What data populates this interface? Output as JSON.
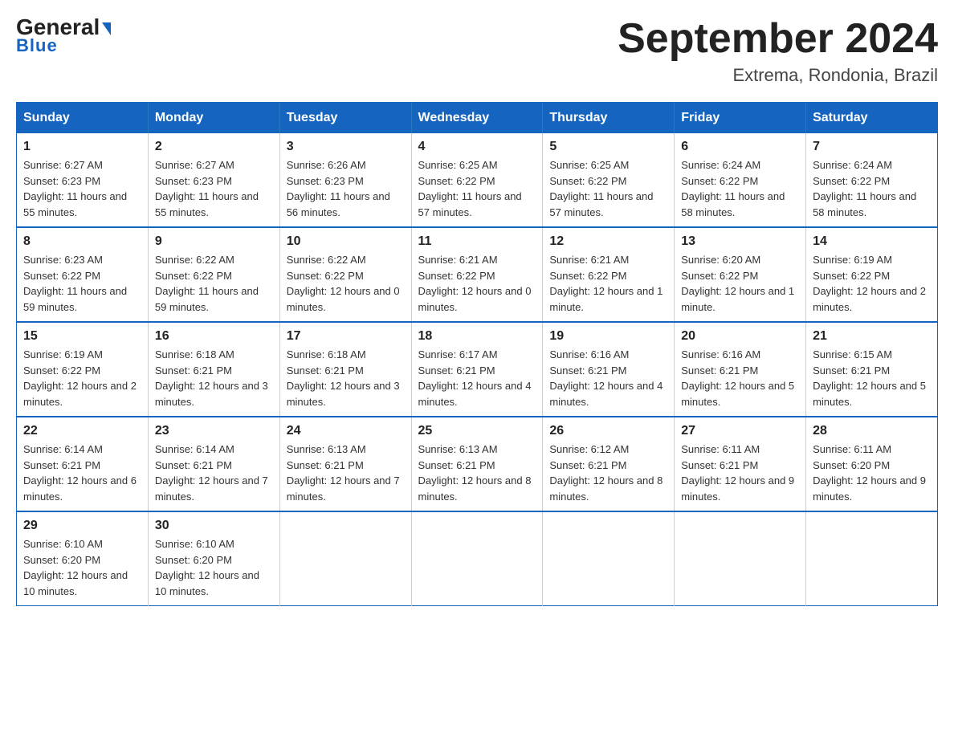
{
  "header": {
    "logo_general": "General",
    "logo_blue": "Blue",
    "title": "September 2024",
    "subtitle": "Extrema, Rondonia, Brazil"
  },
  "days_of_week": [
    "Sunday",
    "Monday",
    "Tuesday",
    "Wednesday",
    "Thursday",
    "Friday",
    "Saturday"
  ],
  "weeks": [
    [
      {
        "day": "1",
        "sunrise": "6:27 AM",
        "sunset": "6:23 PM",
        "daylight": "11 hours and 55 minutes."
      },
      {
        "day": "2",
        "sunrise": "6:27 AM",
        "sunset": "6:23 PM",
        "daylight": "11 hours and 55 minutes."
      },
      {
        "day": "3",
        "sunrise": "6:26 AM",
        "sunset": "6:23 PM",
        "daylight": "11 hours and 56 minutes."
      },
      {
        "day": "4",
        "sunrise": "6:25 AM",
        "sunset": "6:22 PM",
        "daylight": "11 hours and 57 minutes."
      },
      {
        "day": "5",
        "sunrise": "6:25 AM",
        "sunset": "6:22 PM",
        "daylight": "11 hours and 57 minutes."
      },
      {
        "day": "6",
        "sunrise": "6:24 AM",
        "sunset": "6:22 PM",
        "daylight": "11 hours and 58 minutes."
      },
      {
        "day": "7",
        "sunrise": "6:24 AM",
        "sunset": "6:22 PM",
        "daylight": "11 hours and 58 minutes."
      }
    ],
    [
      {
        "day": "8",
        "sunrise": "6:23 AM",
        "sunset": "6:22 PM",
        "daylight": "11 hours and 59 minutes."
      },
      {
        "day": "9",
        "sunrise": "6:22 AM",
        "sunset": "6:22 PM",
        "daylight": "11 hours and 59 minutes."
      },
      {
        "day": "10",
        "sunrise": "6:22 AM",
        "sunset": "6:22 PM",
        "daylight": "12 hours and 0 minutes."
      },
      {
        "day": "11",
        "sunrise": "6:21 AM",
        "sunset": "6:22 PM",
        "daylight": "12 hours and 0 minutes."
      },
      {
        "day": "12",
        "sunrise": "6:21 AM",
        "sunset": "6:22 PM",
        "daylight": "12 hours and 1 minute."
      },
      {
        "day": "13",
        "sunrise": "6:20 AM",
        "sunset": "6:22 PM",
        "daylight": "12 hours and 1 minute."
      },
      {
        "day": "14",
        "sunrise": "6:19 AM",
        "sunset": "6:22 PM",
        "daylight": "12 hours and 2 minutes."
      }
    ],
    [
      {
        "day": "15",
        "sunrise": "6:19 AM",
        "sunset": "6:22 PM",
        "daylight": "12 hours and 2 minutes."
      },
      {
        "day": "16",
        "sunrise": "6:18 AM",
        "sunset": "6:21 PM",
        "daylight": "12 hours and 3 minutes."
      },
      {
        "day": "17",
        "sunrise": "6:18 AM",
        "sunset": "6:21 PM",
        "daylight": "12 hours and 3 minutes."
      },
      {
        "day": "18",
        "sunrise": "6:17 AM",
        "sunset": "6:21 PM",
        "daylight": "12 hours and 4 minutes."
      },
      {
        "day": "19",
        "sunrise": "6:16 AM",
        "sunset": "6:21 PM",
        "daylight": "12 hours and 4 minutes."
      },
      {
        "day": "20",
        "sunrise": "6:16 AM",
        "sunset": "6:21 PM",
        "daylight": "12 hours and 5 minutes."
      },
      {
        "day": "21",
        "sunrise": "6:15 AM",
        "sunset": "6:21 PM",
        "daylight": "12 hours and 5 minutes."
      }
    ],
    [
      {
        "day": "22",
        "sunrise": "6:14 AM",
        "sunset": "6:21 PM",
        "daylight": "12 hours and 6 minutes."
      },
      {
        "day": "23",
        "sunrise": "6:14 AM",
        "sunset": "6:21 PM",
        "daylight": "12 hours and 7 minutes."
      },
      {
        "day": "24",
        "sunrise": "6:13 AM",
        "sunset": "6:21 PM",
        "daylight": "12 hours and 7 minutes."
      },
      {
        "day": "25",
        "sunrise": "6:13 AM",
        "sunset": "6:21 PM",
        "daylight": "12 hours and 8 minutes."
      },
      {
        "day": "26",
        "sunrise": "6:12 AM",
        "sunset": "6:21 PM",
        "daylight": "12 hours and 8 minutes."
      },
      {
        "day": "27",
        "sunrise": "6:11 AM",
        "sunset": "6:21 PM",
        "daylight": "12 hours and 9 minutes."
      },
      {
        "day": "28",
        "sunrise": "6:11 AM",
        "sunset": "6:20 PM",
        "daylight": "12 hours and 9 minutes."
      }
    ],
    [
      {
        "day": "29",
        "sunrise": "6:10 AM",
        "sunset": "6:20 PM",
        "daylight": "12 hours and 10 minutes."
      },
      {
        "day": "30",
        "sunrise": "6:10 AM",
        "sunset": "6:20 PM",
        "daylight": "12 hours and 10 minutes."
      },
      null,
      null,
      null,
      null,
      null
    ]
  ]
}
